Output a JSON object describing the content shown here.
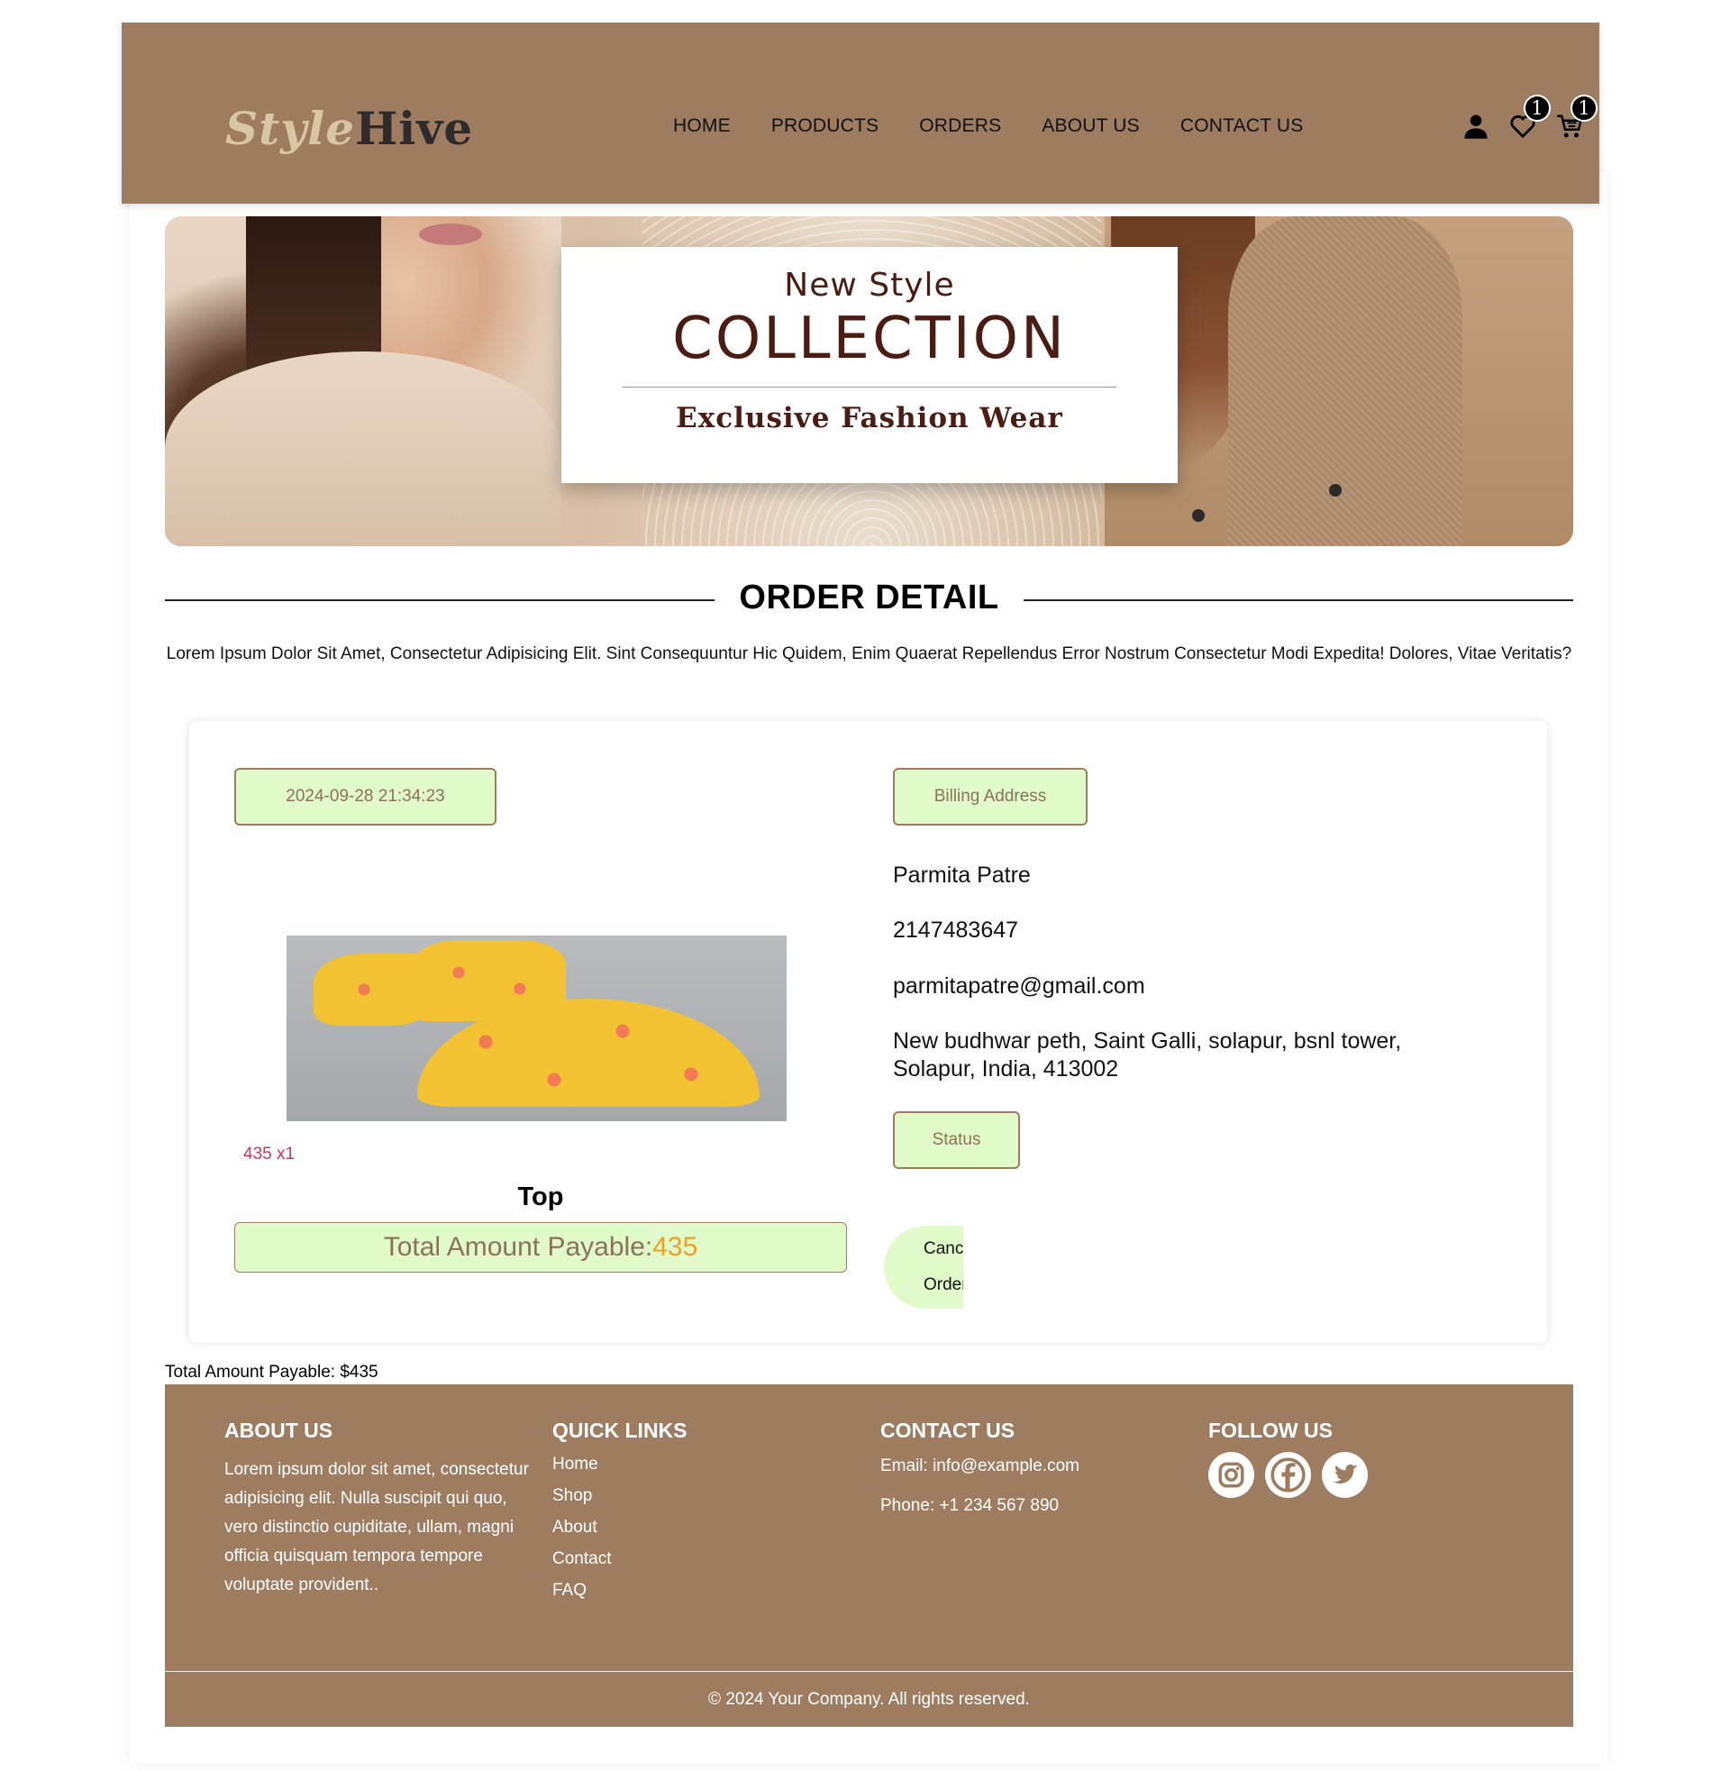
{
  "header": {
    "logo_part1": "Style",
    "logo_part2": "Hive",
    "nav": [
      "HOME",
      "PRODUCTS",
      "ORDERS",
      "ABOUT US",
      "CONTACT US"
    ],
    "wishlist_count": "1",
    "cart_count": "1",
    "icons": [
      "user-icon",
      "heart-icon",
      "cart-icon"
    ]
  },
  "hero": {
    "subtitle": "New Style",
    "title": "COLLECTION",
    "tagline": "Exclusive Fashion Wear"
  },
  "section": {
    "title": "ORDER DETAIL",
    "description": "Lorem Ipsum Dolor Sit Amet, Consectetur Adipisicing Elit. Sint Consequuntur Hic Quidem, Enim Quaerat Repellendus Error Nostrum Consectetur Modi Expedita! Dolores, Vitae Veritatis?"
  },
  "order": {
    "date": "2024-09-28 21:34:23",
    "quantity_label": "435 x1",
    "product_name": "Top",
    "total_label": "Total Amount Payable:",
    "total_value": "435",
    "billing_label": "Billing Address",
    "name": "Parmita Patre",
    "phone": "2147483647",
    "email": "parmitapatre@gmail.com",
    "address_line1": "New budhwar peth, Saint Galli, solapur, bsnl tower,",
    "address_line2": "Solapur, India, 413002",
    "status_label": "Status",
    "cancel_line1": "Cancel",
    "cancel_line2": "Order"
  },
  "below_total": "Total Amount Payable: $435",
  "footer": {
    "about_title": "ABOUT US",
    "about_text": "Lorem ipsum dolor sit amet, consectetur adipisicing elit. Nulla suscipit qui quo, vero distinctio cupiditate, ullam, magni officia quisquam tempora tempore voluptate provident..",
    "links_title": "QUICK LINKS",
    "links": [
      "Home",
      "Shop",
      "About",
      "Contact",
      "FAQ"
    ],
    "contact_title": "CONTACT US",
    "email": "Email: info@example.com",
    "phone": "Phone: +1 234 567 890",
    "follow_title": "FOLLOW US",
    "social_icons": [
      "instagram-icon",
      "facebook-icon",
      "twitter-icon"
    ],
    "copyright": "© 2024 Your Company. All rights reserved."
  },
  "colors": {
    "brand_brown": "#9e7c5f",
    "pill_green": "#e0fac9",
    "accent_orange": "#f0a020",
    "qty_red": "#d0345a"
  }
}
